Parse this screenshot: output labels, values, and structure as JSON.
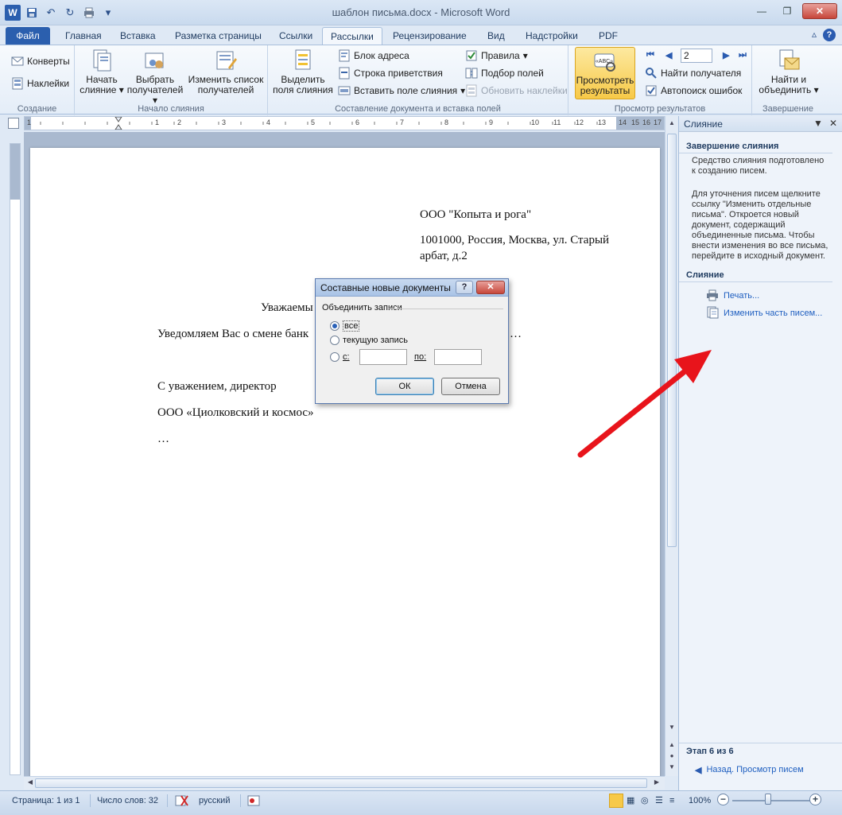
{
  "window": {
    "title": "шаблон письма.docx - Microsoft Word",
    "app_icon": "W",
    "help": "?"
  },
  "tabs": [
    "Файл",
    "Главная",
    "Вставка",
    "Разметка страницы",
    "Ссылки",
    "Рассылки",
    "Рецензирование",
    "Вид",
    "Надстройки",
    "PDF"
  ],
  "active_tab": "Рассылки",
  "ribbon": {
    "groups": {
      "create": "Создание",
      "start": "Начало слияния",
      "compose": "Составление документа и вставка полей",
      "preview": "Просмотр результатов",
      "finish": "Завершение"
    },
    "envelopes": "Конверты",
    "labels": "Наклейки",
    "start_merge": [
      "Начать",
      "слияние"
    ],
    "select_recipients": [
      "Выбрать",
      "получателей"
    ],
    "edit_recipients": [
      "Изменить список",
      "получателей"
    ],
    "highlight_fields": [
      "Выделить",
      "поля слияния"
    ],
    "address_block": "Блок адреса",
    "greeting_line": "Строка приветствия",
    "insert_field": "Вставить поле слияния",
    "rules": "Правила",
    "match_fields": "Подбор полей",
    "update_labels": "Обновить наклейки",
    "preview_results": [
      "Просмотреть",
      "результаты"
    ],
    "record_number": "2",
    "find_recipient": "Найти получателя",
    "auto_check": "Автопоиск ошибок",
    "finish_merge": [
      "Найти и",
      "объединить"
    ],
    "preview_icon_text": "«ABC»"
  },
  "ruler": {
    "numbers": [
      "1",
      "1",
      "2",
      "3",
      "4",
      "5",
      "6",
      "7",
      "8",
      "9",
      "10",
      "11",
      "12",
      "13",
      "14",
      "15",
      "16",
      "17"
    ]
  },
  "document": {
    "company": "ООО \"Копыта и рога\"",
    "address_line1": "1001000, Россия, Москва, ул. Старый",
    "address_line2": "арбат, д.2",
    "greeting_partial": "Уважаемы",
    "body_partial": "Уведомляем Вас о смене банк",
    "body_ellipsis": "…",
    "sign_off": "С уважением, директор",
    "signature_company": "ООО «Циолковский и космос»",
    "trailing_ellipsis": "…"
  },
  "dialog": {
    "title": "Составные новые документы",
    "group_label": "Объединить записи",
    "option_all": "все",
    "option_current": "текущую запись",
    "option_from": "с:",
    "to_label": "по:",
    "from_value": "",
    "to_value": "",
    "ok": "ОК",
    "cancel": "Отмена",
    "selected": "all"
  },
  "task_pane": {
    "title": "Слияние",
    "section1_title": "Завершение слияния",
    "text1": "Средство слияния подготовлено к созданию писем.",
    "text2": "Для уточнения писем щелкните ссылку \"Изменить отдельные письма\". Откроется новый документ, содержащий объединенные письма. Чтобы внести изменения во все письма, перейдите в исходный документ.",
    "section2_title": "Слияние",
    "link_print": "Печать...",
    "link_edit": "Изменить часть писем...",
    "step": "Этап 6 из 6",
    "back_link": "Назад. Просмотр писем"
  },
  "statusbar": {
    "page": "Страница: 1 из 1",
    "words": "Число слов: 32",
    "language": "русский",
    "zoom": "100%",
    "zoom_minus": "−",
    "zoom_plus": "+"
  },
  "colors": {
    "accent": "#2b5fae",
    "annotation_arrow": "#e8141b",
    "link": "#1f5fc0"
  }
}
